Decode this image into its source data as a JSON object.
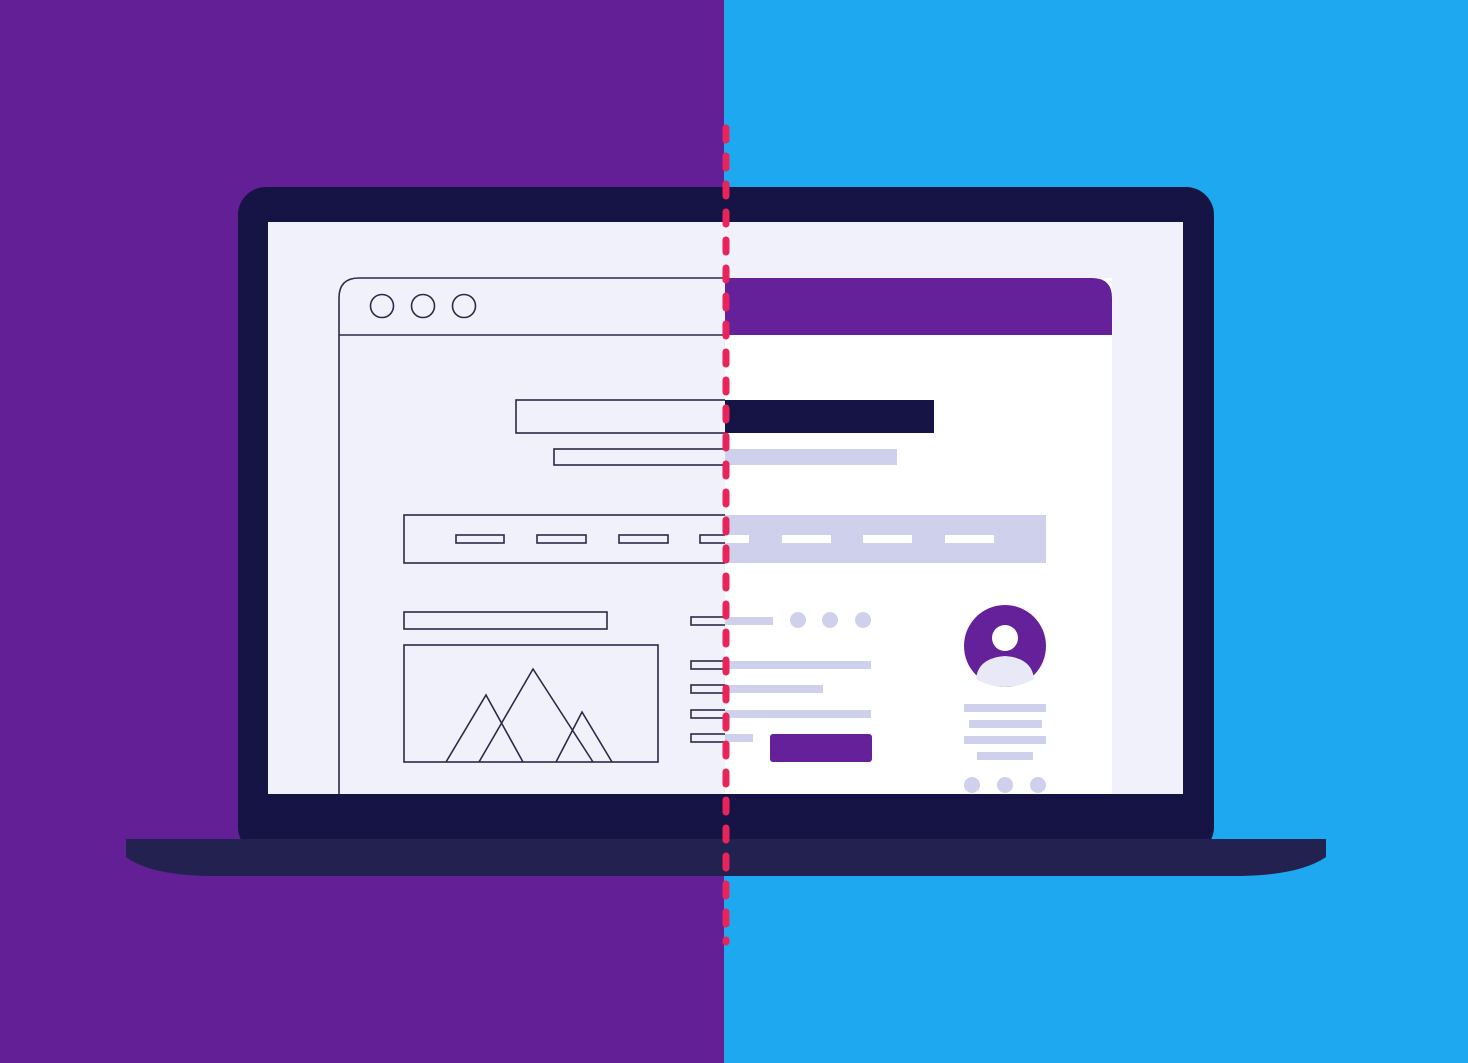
{
  "colors": {
    "left_background": "#621f96",
    "right_background": "#1ea8ef",
    "laptop_bezel": "#151445",
    "laptop_base": "#22214f",
    "screen": "#f1f1fc",
    "wireframe_stroke": "#2a2a4a",
    "header_purple": "#65219a",
    "title_bar": "#151445",
    "placeholder_lavender": "#cfd0eb",
    "divider_red": "#e8245a",
    "white": "#ffffff"
  },
  "icons": {
    "window_controls": "three-circles",
    "image_placeholder": "mountains",
    "avatar": "user-profile",
    "pagination": "three-dots"
  }
}
